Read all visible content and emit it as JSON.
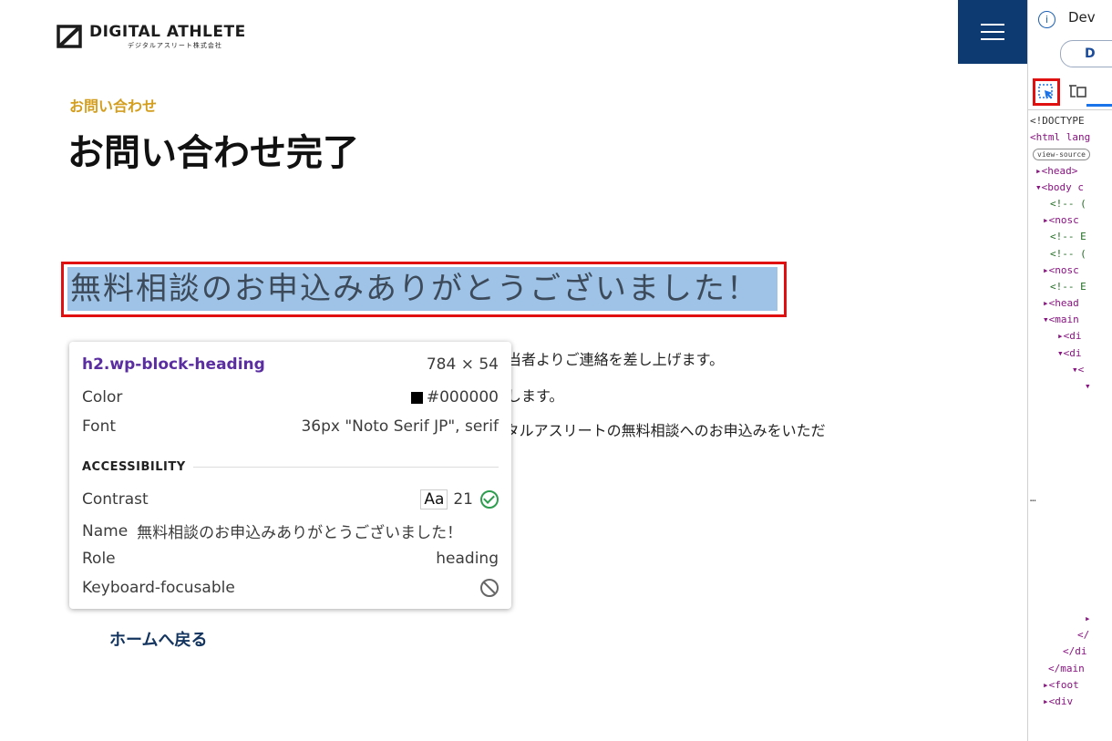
{
  "site": {
    "logo": {
      "main": "DIGITAL ATHLETE",
      "sub": "デジタルアスリート株式会社",
      "icon": "logo-mark-icon"
    },
    "menu": {
      "icon": "hamburger-menu-icon"
    },
    "eyebrow": "お問い合わせ",
    "page_title": "お問い合わせ完了",
    "heading": "無料相談のお申込みありがとうございました！",
    "body_lines": [
      "担当者よりご連絡を差し上げます。",
      "たします。",
      "ジタルアスリートの無料相談へのお申込みをいただ"
    ],
    "home_link": "ホームへ戻る",
    "accent_color": "#d39e1e",
    "brand_color": "#0d3a70"
  },
  "tooltip": {
    "selector": "h2.wp-block-heading",
    "size": "784 × 54",
    "color_label": "Color",
    "color_value": "#000000",
    "font_label": "Font",
    "font_value": "36px \"Noto Serif JP\", serif",
    "section": "ACCESSIBILITY",
    "contrast_label": "Contrast",
    "contrast_aa": "Aa",
    "contrast_value": "21",
    "name_label": "Name",
    "name_value": "無料相談のお申込みありがとうございました！",
    "role_label": "Role",
    "role_value": "heading",
    "focus_label": "Keyboard-focusable"
  },
  "devtools": {
    "notice": "Dev",
    "pill": "D",
    "code_lines": [
      "<!DOCTYPE",
      "<html lang",
      "view-source",
      "▸<head>",
      "▾<body c",
      "<!-- (",
      "▸<nosc",
      "<!-- E",
      "<!-- (",
      "▸<nosc",
      "<!-- E",
      "▸<head",
      "▾<main",
      "▸<di",
      "▾<di",
      "▾<",
      "▾"
    ],
    "code_tail": [
      "▸",
      "</",
      "</di",
      "</main",
      "▸<foot",
      "▸<div"
    ],
    "ellipsis": "…"
  }
}
